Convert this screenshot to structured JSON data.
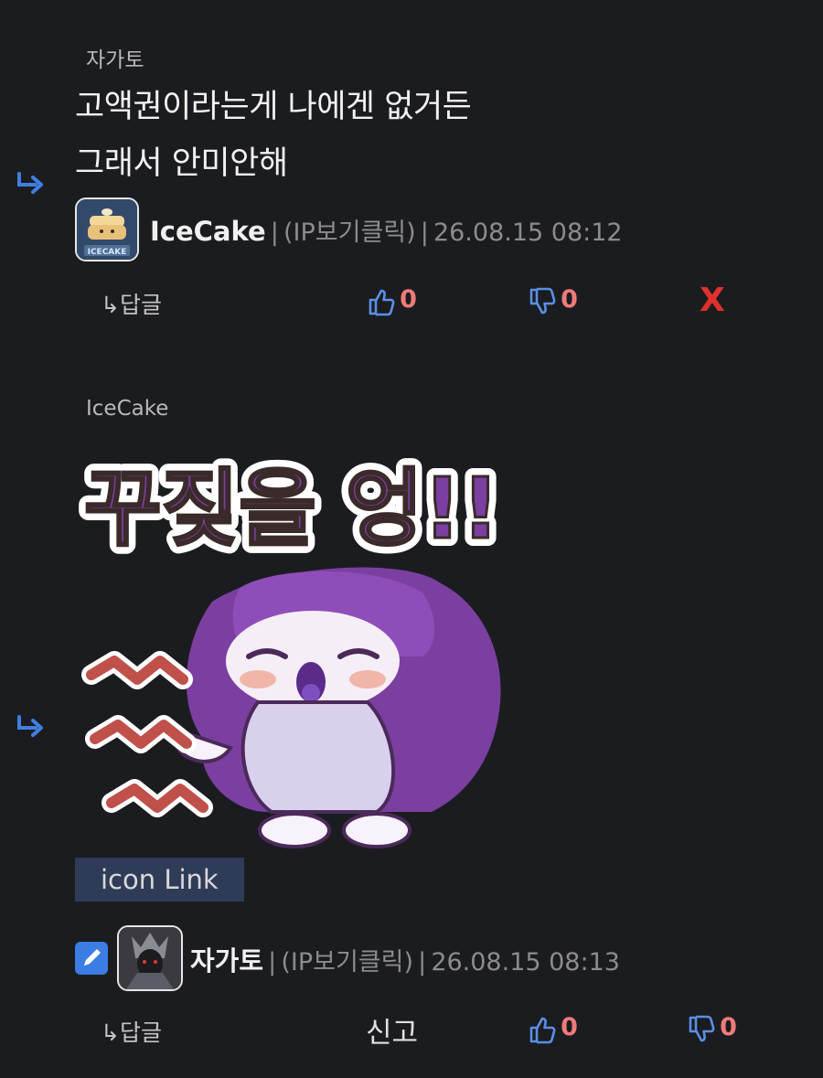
{
  "comments": [
    {
      "reply_to": "자가토",
      "lines": [
        "고액권이라는게 나에겐 없거든",
        "그래서 안미안해"
      ],
      "author": "IceCake",
      "ip_label": "(IP보기클릭)",
      "timestamp": "26.08.15 08:12",
      "reply_label": "↳답글",
      "likes": "0",
      "dislikes": "0",
      "delete_label": "X",
      "avatar_text": "ICECAKE"
    },
    {
      "reply_to": "IceCake",
      "sticker_text": "꾸짖을 엉!!",
      "icon_link_label": "icon Link",
      "author": "자가토",
      "ip_label": "(IP보기클릭)",
      "timestamp": "26.08.15 08:13",
      "reply_label": "↳답글",
      "report_label": "신고",
      "likes": "0",
      "dislikes": "0"
    }
  ],
  "separator": "|",
  "colors": {
    "background": "#1b1c20",
    "accent_blue": "#3f7fe0",
    "count_red": "#f07a7a",
    "delete_red": "#e2302c",
    "icon_link_bg": "#2e3c57"
  },
  "icons": {
    "reply_arrow": "reply-arrow-icon",
    "like": "thumbs-up-icon",
    "dislike": "thumbs-down-icon",
    "edit": "pencil-icon"
  }
}
